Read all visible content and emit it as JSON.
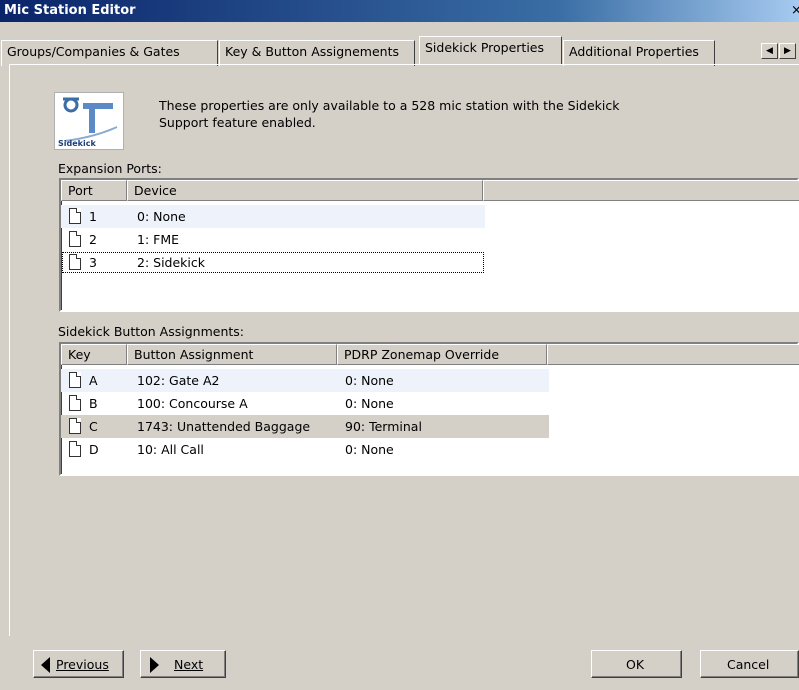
{
  "window": {
    "title": "Mic Station Editor",
    "close_glyph": "×"
  },
  "tabs": [
    {
      "label": "Groups/Companies & Gates"
    },
    {
      "label": "Key & Button Assignements"
    },
    {
      "label": "Sidekick Properties",
      "active": true
    },
    {
      "label": "Additional Properties"
    }
  ],
  "tab_scroll": {
    "left_icon": "scroll-left-icon",
    "right_icon": "scroll-right-icon"
  },
  "info": {
    "icon": "sidekick-logo-icon",
    "logo_text": "Sidekick",
    "text_line1": "These properties are only available to a 528 mic station with the Sidekick",
    "text_line2": "Support feature enabled."
  },
  "expansion_ports": {
    "label": "Expansion Ports:",
    "columns": [
      "Port",
      "Device"
    ],
    "rows": [
      {
        "port": "1",
        "device": "0: None",
        "icon": "document-icon"
      },
      {
        "port": "2",
        "device": "1: FME",
        "icon": "document-icon"
      },
      {
        "port": "3",
        "device": "2: Sidekick",
        "icon": "document-icon",
        "focused": true
      }
    ]
  },
  "sidekick_buttons": {
    "label": "Sidekick Button Assignments:",
    "columns": [
      "Key",
      "Button Assignment",
      "PDRP Zonemap Override"
    ],
    "rows": [
      {
        "key": "A",
        "assignment": "102: Gate A2",
        "override": "0: None",
        "icon": "document-icon"
      },
      {
        "key": "B",
        "assignment": "100: Concourse A",
        "override": "0: None",
        "icon": "document-icon"
      },
      {
        "key": "C",
        "assignment": "1743: Unattended Baggage",
        "override": "90: Terminal",
        "icon": "document-icon",
        "selected": true
      },
      {
        "key": "D",
        "assignment": "10: All Call",
        "override": "0: None",
        "icon": "document-icon"
      }
    ]
  },
  "footer": {
    "previous_label": "Previous",
    "next_label": "Next",
    "ok_label": "OK",
    "cancel_label": "Cancel"
  },
  "colors": {
    "title_gradient_start": "#0a246a",
    "window_background": "#d4d0c8",
    "row_hover": "#eef2fa",
    "row_selected": "#d4d0c8"
  }
}
